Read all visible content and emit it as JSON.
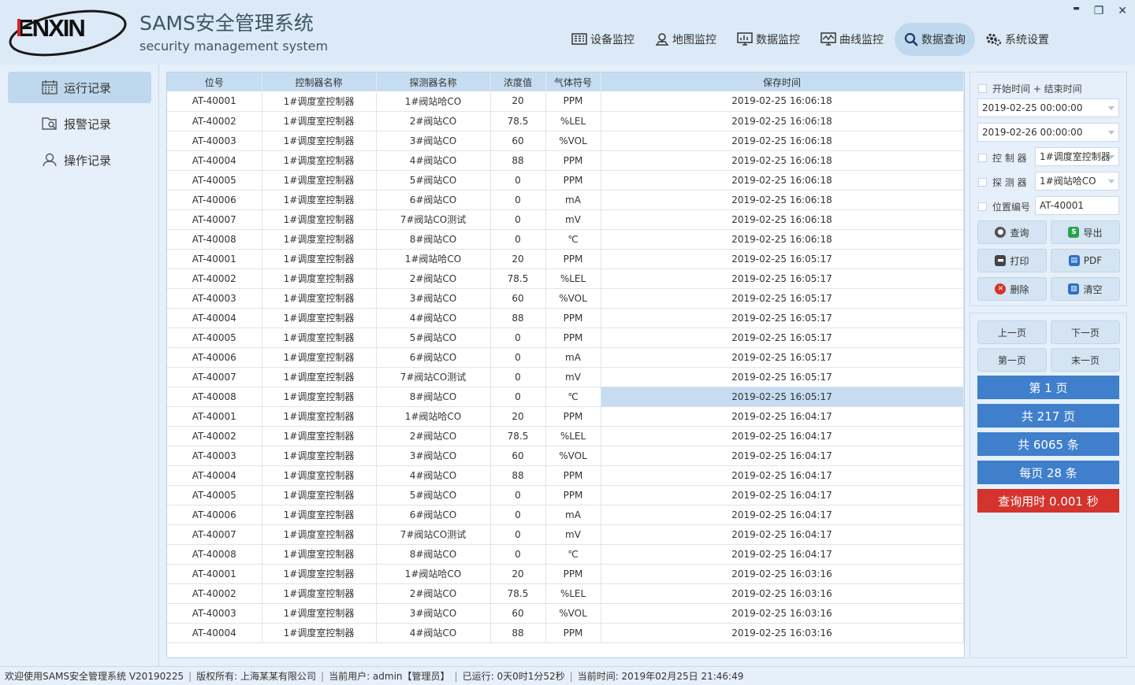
{
  "app": {
    "title": "SAMS安全管理系统",
    "subtitle": "security management system",
    "logo_text": "ENXIN"
  },
  "window_controls": {
    "minimize": "▬",
    "restore": "❐",
    "close": "✕"
  },
  "nav": [
    {
      "label": "设备监控",
      "icon": "device-monitor-icon"
    },
    {
      "label": "地图监控",
      "icon": "map-monitor-icon"
    },
    {
      "label": "数据监控",
      "icon": "data-monitor-icon"
    },
    {
      "label": "曲线监控",
      "icon": "curve-monitor-icon"
    },
    {
      "label": "数据查询",
      "icon": "search-icon",
      "active": true
    },
    {
      "label": "系统设置",
      "icon": "gear-icon"
    }
  ],
  "sidebar": [
    {
      "label": "运行记录",
      "icon": "calendar-icon",
      "active": true
    },
    {
      "label": "报警记录",
      "icon": "alarm-record-icon"
    },
    {
      "label": "操作记录",
      "icon": "user-icon"
    }
  ],
  "table": {
    "columns": [
      "位号",
      "控制器名称",
      "探测器名称",
      "浓度值",
      "气体符号",
      "保存时间"
    ],
    "selected_row": 15,
    "rows": [
      [
        "AT-40001",
        "1#调度室控制器",
        "1#阀站哈CO",
        "20",
        "PPM",
        "2019-02-25 16:06:18"
      ],
      [
        "AT-40002",
        "1#调度室控制器",
        "2#阀站CO",
        "78.5",
        "%LEL",
        "2019-02-25 16:06:18"
      ],
      [
        "AT-40003",
        "1#调度室控制器",
        "3#阀站CO",
        "60",
        "%VOL",
        "2019-02-25 16:06:18"
      ],
      [
        "AT-40004",
        "1#调度室控制器",
        "4#阀站CO",
        "88",
        "PPM",
        "2019-02-25 16:06:18"
      ],
      [
        "AT-40005",
        "1#调度室控制器",
        "5#阀站CO",
        "0",
        "PPM",
        "2019-02-25 16:06:18"
      ],
      [
        "AT-40006",
        "1#调度室控制器",
        "6#阀站CO",
        "0",
        "mA",
        "2019-02-25 16:06:18"
      ],
      [
        "AT-40007",
        "1#调度室控制器",
        "7#阀站CO测试",
        "0",
        "mV",
        "2019-02-25 16:06:18"
      ],
      [
        "AT-40008",
        "1#调度室控制器",
        "8#阀站CO",
        "0",
        "℃",
        "2019-02-25 16:06:18"
      ],
      [
        "AT-40001",
        "1#调度室控制器",
        "1#阀站哈CO",
        "20",
        "PPM",
        "2019-02-25 16:05:17"
      ],
      [
        "AT-40002",
        "1#调度室控制器",
        "2#阀站CO",
        "78.5",
        "%LEL",
        "2019-02-25 16:05:17"
      ],
      [
        "AT-40003",
        "1#调度室控制器",
        "3#阀站CO",
        "60",
        "%VOL",
        "2019-02-25 16:05:17"
      ],
      [
        "AT-40004",
        "1#调度室控制器",
        "4#阀站CO",
        "88",
        "PPM",
        "2019-02-25 16:05:17"
      ],
      [
        "AT-40005",
        "1#调度室控制器",
        "5#阀站CO",
        "0",
        "PPM",
        "2019-02-25 16:05:17"
      ],
      [
        "AT-40006",
        "1#调度室控制器",
        "6#阀站CO",
        "0",
        "mA",
        "2019-02-25 16:05:17"
      ],
      [
        "AT-40007",
        "1#调度室控制器",
        "7#阀站CO测试",
        "0",
        "mV",
        "2019-02-25 16:05:17"
      ],
      [
        "AT-40008",
        "1#调度室控制器",
        "8#阀站CO",
        "0",
        "℃",
        "2019-02-25 16:05:17"
      ],
      [
        "AT-40001",
        "1#调度室控制器",
        "1#阀站哈CO",
        "20",
        "PPM",
        "2019-02-25 16:04:17"
      ],
      [
        "AT-40002",
        "1#调度室控制器",
        "2#阀站CO",
        "78.5",
        "%LEL",
        "2019-02-25 16:04:17"
      ],
      [
        "AT-40003",
        "1#调度室控制器",
        "3#阀站CO",
        "60",
        "%VOL",
        "2019-02-25 16:04:17"
      ],
      [
        "AT-40004",
        "1#调度室控制器",
        "4#阀站CO",
        "88",
        "PPM",
        "2019-02-25 16:04:17"
      ],
      [
        "AT-40005",
        "1#调度室控制器",
        "5#阀站CO",
        "0",
        "PPM",
        "2019-02-25 16:04:17"
      ],
      [
        "AT-40006",
        "1#调度室控制器",
        "6#阀站CO",
        "0",
        "mA",
        "2019-02-25 16:04:17"
      ],
      [
        "AT-40007",
        "1#调度室控制器",
        "7#阀站CO测试",
        "0",
        "mV",
        "2019-02-25 16:04:17"
      ],
      [
        "AT-40008",
        "1#调度室控制器",
        "8#阀站CO",
        "0",
        "℃",
        "2019-02-25 16:04:17"
      ],
      [
        "AT-40001",
        "1#调度室控制器",
        "1#阀站哈CO",
        "20",
        "PPM",
        "2019-02-25 16:03:16"
      ],
      [
        "AT-40002",
        "1#调度室控制器",
        "2#阀站CO",
        "78.5",
        "%LEL",
        "2019-02-25 16:03:16"
      ],
      [
        "AT-40003",
        "1#调度室控制器",
        "3#阀站CO",
        "60",
        "%VOL",
        "2019-02-25 16:03:16"
      ],
      [
        "AT-40004",
        "1#调度室控制器",
        "4#阀站CO",
        "88",
        "PPM",
        "2019-02-25 16:03:16"
      ]
    ]
  },
  "filters": {
    "time_label": "开始时间 + 结束时间",
    "start_time": "2019-02-25 00:00:00",
    "end_time": "2019-02-26 00:00:00",
    "controller_label": "控 制 器",
    "controller_value": "1#调度室控制器",
    "detector_label": "探 测 器",
    "detector_value": "1#阀站哈CO",
    "position_label": "位置编号",
    "position_value": "AT-40001"
  },
  "actions": {
    "query": "查询",
    "export": "导出",
    "print": "打印",
    "pdf": "PDF",
    "delete": "删除",
    "clear": "清空"
  },
  "paging": {
    "prev": "上一页",
    "next": "下一页",
    "first": "第一页",
    "last": "末一页",
    "current_page": "第 1 页",
    "total_pages": "共 217 页",
    "total_records": "共 6065 条",
    "per_page": "每页 28 条",
    "query_time": "查询用时 0.001 秒"
  },
  "colors": {
    "accent_blue": "#3f7fcc",
    "alert_red": "#d5332d",
    "header_bg": "#dceaf7",
    "selected_bg": "#c6dcf0"
  },
  "status": {
    "welcome": "欢迎使用SAMS安全管理系统 V20190225",
    "copyright": "版权所有: 上海某某有限公司",
    "user": "当前用户: admin【管理员】",
    "runtime": "已运行: 0天0时1分52秒",
    "now": "当前时间: 2019年02月25日 21:46:49"
  }
}
